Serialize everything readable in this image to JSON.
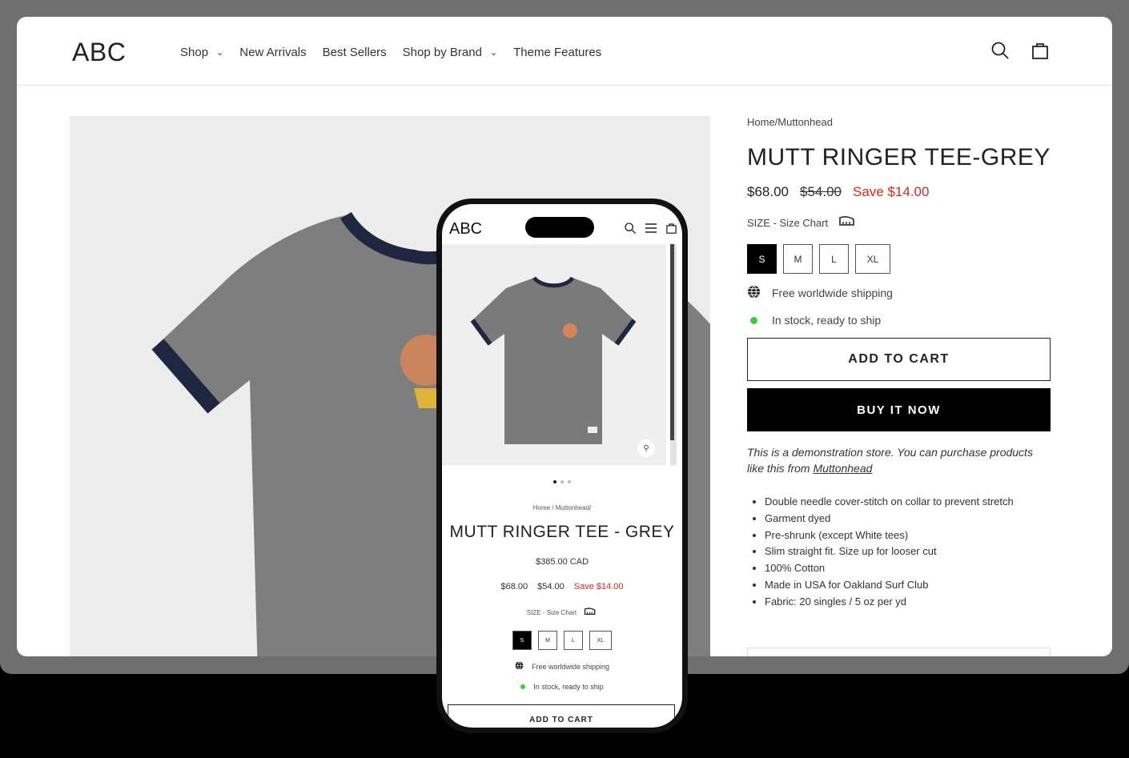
{
  "header": {
    "logo": "ABC",
    "nav": [
      {
        "label": "Shop",
        "dropdown": true
      },
      {
        "label": "New Arrivals",
        "dropdown": false
      },
      {
        "label": "Best Sellers",
        "dropdown": false
      },
      {
        "label": "Shop by Brand",
        "dropdown": true
      },
      {
        "label": "Theme Features",
        "dropdown": false
      }
    ],
    "icons": [
      "search-icon",
      "bag-icon"
    ]
  },
  "product": {
    "breadcrumb": "Home/Muttonhead",
    "title": "MUTT RINGER TEE-GREY",
    "price": "$68.00",
    "compare_price": "$54.00",
    "save": "Save $14.00",
    "size_label": "SIZE - Size Chart",
    "sizes": [
      "S",
      "M",
      "L",
      "XL"
    ],
    "selected_size": "S",
    "shipping": "Free worldwide shipping",
    "stock": "In stock, ready to ship",
    "add_to_cart": "ADD TO CART",
    "buy_now": "BUY IT NOW",
    "demo_text": "This is a demonstration store. You can purchase products like this from",
    "demo_link": "Muttonhead",
    "features": [
      "Double needle cover-stitch on collar to prevent stretch",
      "Garment dyed",
      "Pre-shrunk (except White tees)",
      "Slim straight fit. Size up for looser cut",
      "100% Cotton",
      "Made in USA for Oakland Surf Club",
      "Fabric: 20 singles / 5 oz per yd"
    ]
  },
  "mobile": {
    "logo": "ABC",
    "breadcrumb": "Home / Muttonhead/",
    "title": "MUTT RINGER TEE - GREY",
    "cad_price": "$385.00 CAD",
    "price": "$68.00",
    "compare_price": "$54.00",
    "save": "Save $14.00",
    "size_label": "SIZE - Size Chart",
    "sizes": [
      "S",
      "M",
      "L",
      "XL"
    ],
    "shipping": "Free worldwide shipping",
    "stock": "In stock, ready to ship",
    "add_to_cart": "ADD TO CART",
    "carousel_dots": 3
  },
  "colors": {
    "accent_save": "#d0291c",
    "in_stock": "#3bcc3b",
    "button_dark": "#000000"
  }
}
